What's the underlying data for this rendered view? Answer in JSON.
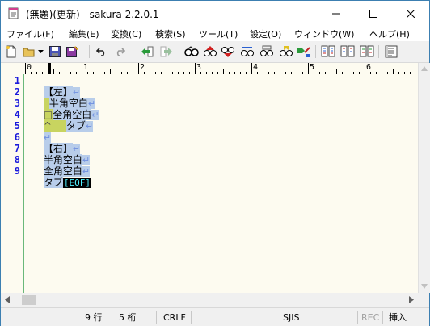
{
  "window": {
    "title": "(無題)(更新) - sakura 2.2.0.1"
  },
  "menu": [
    {
      "label": "ファイル(F)"
    },
    {
      "label": "編集(E)"
    },
    {
      "label": "変換(C)"
    },
    {
      "label": "検索(S)"
    },
    {
      "label": "ツール(T)"
    },
    {
      "label": "設定(O)"
    },
    {
      "label": "ウィンドウ(W)"
    },
    {
      "label": "ヘルプ(H)"
    }
  ],
  "toolbar": {
    "icons": [
      "new-file-icon",
      "open-folder-icon",
      "dropdown-arrow-icon",
      "save-icon",
      "save-as-icon",
      "undo-icon",
      "redo-icon",
      "back-icon",
      "forward-icon",
      "find-icon",
      "find-prev-icon",
      "find-next-icon",
      "replace-icon",
      "grep-icon",
      "bookmark-icon",
      "jump-icon",
      "compare-icon",
      "sort-icon",
      "settings-icon",
      "outline-icon"
    ]
  },
  "ruler": {
    "labels": [
      "0",
      "1",
      "2",
      "3",
      "4",
      "5",
      "6"
    ]
  },
  "editor": {
    "line_numbers": [
      "1",
      "2",
      "3",
      "4",
      "5",
      "6",
      "7",
      "8",
      "9"
    ],
    "lines": [
      {
        "text": "【左】",
        "ret": "↵"
      },
      {
        "prefix": "",
        "text": "半角空白",
        "ret": "↵"
      },
      {
        "prefix": "□",
        "text": "全角空白",
        "ret": "↵"
      },
      {
        "prefix": "^",
        "text": "タブ",
        "ret": "↵"
      },
      {
        "text": "",
        "ret": "↵"
      },
      {
        "text": "【右】",
        "ret": "↵"
      },
      {
        "text": "半角空白",
        "ret": "↵"
      },
      {
        "text": "全角空白",
        "ret": "↵"
      },
      {
        "text": "タブ",
        "eof": "[EOF]"
      }
    ]
  },
  "status": {
    "row": "9 行",
    "col": "5 桁",
    "eol": "CRLF",
    "encoding": "SJIS",
    "rec": "REC",
    "mode": "挿入"
  },
  "colors": {
    "line_number": "#1a1adc",
    "selection": "#b8cdea",
    "background": "#fdfbf0",
    "eof_bg": "#000000",
    "eof_fg": "#4ef0ff"
  }
}
